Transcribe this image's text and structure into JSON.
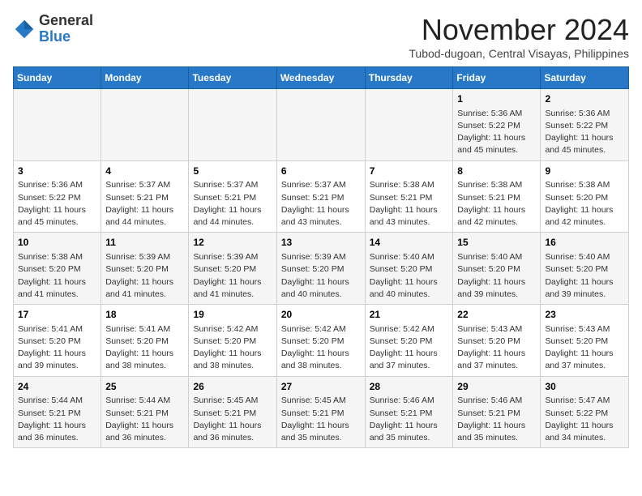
{
  "logo": {
    "line1": "General",
    "line2": "Blue"
  },
  "header": {
    "month": "November 2024",
    "location": "Tubod-dugoan, Central Visayas, Philippines"
  },
  "weekdays": [
    "Sunday",
    "Monday",
    "Tuesday",
    "Wednesday",
    "Thursday",
    "Friday",
    "Saturday"
  ],
  "weeks": [
    [
      {
        "day": "",
        "info": ""
      },
      {
        "day": "",
        "info": ""
      },
      {
        "day": "",
        "info": ""
      },
      {
        "day": "",
        "info": ""
      },
      {
        "day": "",
        "info": ""
      },
      {
        "day": "1",
        "info": "Sunrise: 5:36 AM\nSunset: 5:22 PM\nDaylight: 11 hours and 45 minutes."
      },
      {
        "day": "2",
        "info": "Sunrise: 5:36 AM\nSunset: 5:22 PM\nDaylight: 11 hours and 45 minutes."
      }
    ],
    [
      {
        "day": "3",
        "info": "Sunrise: 5:36 AM\nSunset: 5:22 PM\nDaylight: 11 hours and 45 minutes."
      },
      {
        "day": "4",
        "info": "Sunrise: 5:37 AM\nSunset: 5:21 PM\nDaylight: 11 hours and 44 minutes."
      },
      {
        "day": "5",
        "info": "Sunrise: 5:37 AM\nSunset: 5:21 PM\nDaylight: 11 hours and 44 minutes."
      },
      {
        "day": "6",
        "info": "Sunrise: 5:37 AM\nSunset: 5:21 PM\nDaylight: 11 hours and 43 minutes."
      },
      {
        "day": "7",
        "info": "Sunrise: 5:38 AM\nSunset: 5:21 PM\nDaylight: 11 hours and 43 minutes."
      },
      {
        "day": "8",
        "info": "Sunrise: 5:38 AM\nSunset: 5:21 PM\nDaylight: 11 hours and 42 minutes."
      },
      {
        "day": "9",
        "info": "Sunrise: 5:38 AM\nSunset: 5:20 PM\nDaylight: 11 hours and 42 minutes."
      }
    ],
    [
      {
        "day": "10",
        "info": "Sunrise: 5:38 AM\nSunset: 5:20 PM\nDaylight: 11 hours and 41 minutes."
      },
      {
        "day": "11",
        "info": "Sunrise: 5:39 AM\nSunset: 5:20 PM\nDaylight: 11 hours and 41 minutes."
      },
      {
        "day": "12",
        "info": "Sunrise: 5:39 AM\nSunset: 5:20 PM\nDaylight: 11 hours and 41 minutes."
      },
      {
        "day": "13",
        "info": "Sunrise: 5:39 AM\nSunset: 5:20 PM\nDaylight: 11 hours and 40 minutes."
      },
      {
        "day": "14",
        "info": "Sunrise: 5:40 AM\nSunset: 5:20 PM\nDaylight: 11 hours and 40 minutes."
      },
      {
        "day": "15",
        "info": "Sunrise: 5:40 AM\nSunset: 5:20 PM\nDaylight: 11 hours and 39 minutes."
      },
      {
        "day": "16",
        "info": "Sunrise: 5:40 AM\nSunset: 5:20 PM\nDaylight: 11 hours and 39 minutes."
      }
    ],
    [
      {
        "day": "17",
        "info": "Sunrise: 5:41 AM\nSunset: 5:20 PM\nDaylight: 11 hours and 39 minutes."
      },
      {
        "day": "18",
        "info": "Sunrise: 5:41 AM\nSunset: 5:20 PM\nDaylight: 11 hours and 38 minutes."
      },
      {
        "day": "19",
        "info": "Sunrise: 5:42 AM\nSunset: 5:20 PM\nDaylight: 11 hours and 38 minutes."
      },
      {
        "day": "20",
        "info": "Sunrise: 5:42 AM\nSunset: 5:20 PM\nDaylight: 11 hours and 38 minutes."
      },
      {
        "day": "21",
        "info": "Sunrise: 5:42 AM\nSunset: 5:20 PM\nDaylight: 11 hours and 37 minutes."
      },
      {
        "day": "22",
        "info": "Sunrise: 5:43 AM\nSunset: 5:20 PM\nDaylight: 11 hours and 37 minutes."
      },
      {
        "day": "23",
        "info": "Sunrise: 5:43 AM\nSunset: 5:20 PM\nDaylight: 11 hours and 37 minutes."
      }
    ],
    [
      {
        "day": "24",
        "info": "Sunrise: 5:44 AM\nSunset: 5:21 PM\nDaylight: 11 hours and 36 minutes."
      },
      {
        "day": "25",
        "info": "Sunrise: 5:44 AM\nSunset: 5:21 PM\nDaylight: 11 hours and 36 minutes."
      },
      {
        "day": "26",
        "info": "Sunrise: 5:45 AM\nSunset: 5:21 PM\nDaylight: 11 hours and 36 minutes."
      },
      {
        "day": "27",
        "info": "Sunrise: 5:45 AM\nSunset: 5:21 PM\nDaylight: 11 hours and 35 minutes."
      },
      {
        "day": "28",
        "info": "Sunrise: 5:46 AM\nSunset: 5:21 PM\nDaylight: 11 hours and 35 minutes."
      },
      {
        "day": "29",
        "info": "Sunrise: 5:46 AM\nSunset: 5:21 PM\nDaylight: 11 hours and 35 minutes."
      },
      {
        "day": "30",
        "info": "Sunrise: 5:47 AM\nSunset: 5:22 PM\nDaylight: 11 hours and 34 minutes."
      }
    ]
  ]
}
